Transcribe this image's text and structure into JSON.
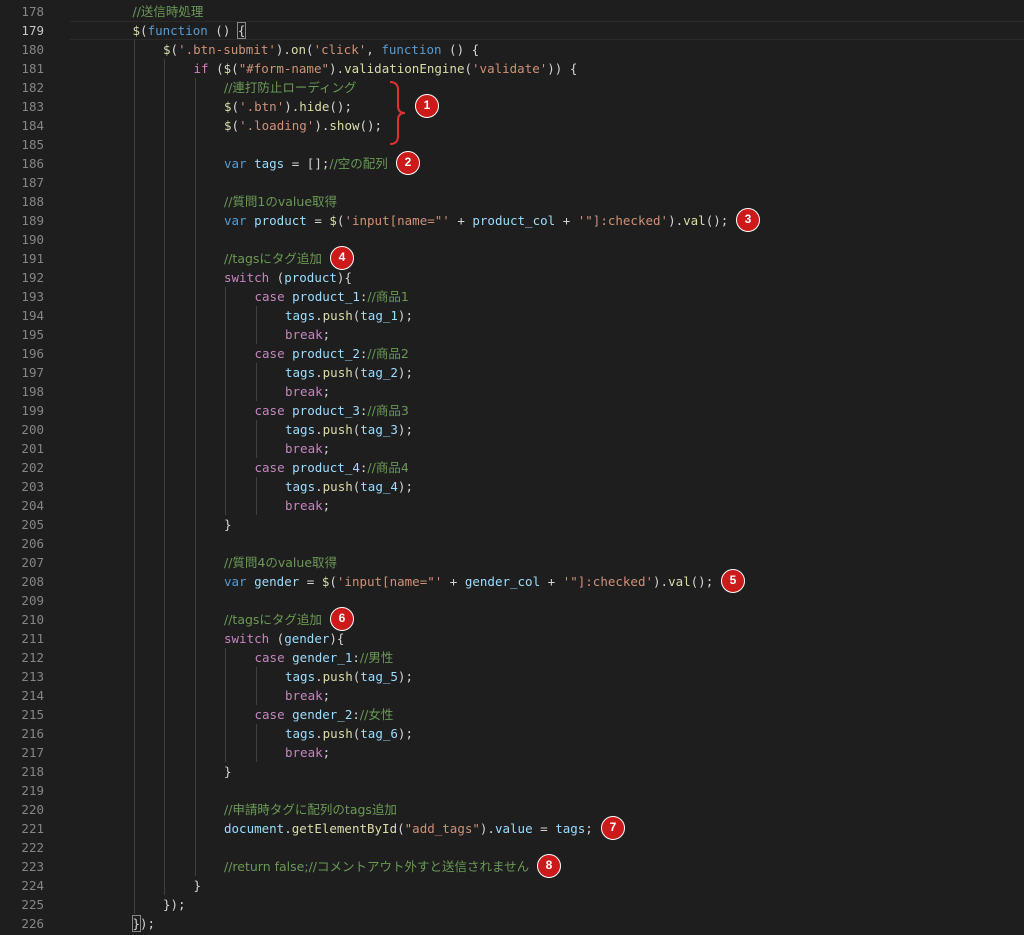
{
  "editor": {
    "active_line": "179",
    "lines": [
      {
        "num": "178"
      },
      {
        "num": "179"
      },
      {
        "num": "180"
      },
      {
        "num": "181"
      },
      {
        "num": "182"
      },
      {
        "num": "183"
      },
      {
        "num": "184"
      },
      {
        "num": "185"
      },
      {
        "num": "186"
      },
      {
        "num": "187"
      },
      {
        "num": "188"
      },
      {
        "num": "189"
      },
      {
        "num": "190"
      },
      {
        "num": "191"
      },
      {
        "num": "192"
      },
      {
        "num": "193"
      },
      {
        "num": "194"
      },
      {
        "num": "195"
      },
      {
        "num": "196"
      },
      {
        "num": "197"
      },
      {
        "num": "198"
      },
      {
        "num": "199"
      },
      {
        "num": "200"
      },
      {
        "num": "201"
      },
      {
        "num": "202"
      },
      {
        "num": "203"
      },
      {
        "num": "204"
      },
      {
        "num": "205"
      },
      {
        "num": "206"
      },
      {
        "num": "207"
      },
      {
        "num": "208"
      },
      {
        "num": "209"
      },
      {
        "num": "210"
      },
      {
        "num": "211"
      },
      {
        "num": "212"
      },
      {
        "num": "213"
      },
      {
        "num": "214"
      },
      {
        "num": "215"
      },
      {
        "num": "216"
      },
      {
        "num": "217"
      },
      {
        "num": "218"
      },
      {
        "num": "219"
      },
      {
        "num": "220"
      },
      {
        "num": "221"
      },
      {
        "num": "222"
      },
      {
        "num": "223"
      },
      {
        "num": "224"
      },
      {
        "num": "225"
      },
      {
        "num": "226"
      }
    ],
    "code": [
      {
        "indent": 1,
        "tokens": [
          {
            "t": "c",
            "v": "//送信時処理"
          }
        ]
      },
      {
        "indent": 1,
        "tokens": [
          {
            "t": "f",
            "v": "$"
          },
          {
            "t": "p",
            "v": "("
          },
          {
            "t": "k",
            "v": "function"
          },
          {
            "t": "p",
            "v": " () "
          },
          {
            "t": "p",
            "v": "{",
            "hl": true
          }
        ]
      },
      {
        "indent": 2,
        "tokens": [
          {
            "t": "f",
            "v": "$"
          },
          {
            "t": "p",
            "v": "("
          },
          {
            "t": "s",
            "v": "'.btn-submit'"
          },
          {
            "t": "p",
            "v": ")."
          },
          {
            "t": "f",
            "v": "on"
          },
          {
            "t": "p",
            "v": "("
          },
          {
            "t": "s",
            "v": "'click'"
          },
          {
            "t": "p",
            "v": ", "
          },
          {
            "t": "k",
            "v": "function"
          },
          {
            "t": "p",
            "v": " () {"
          }
        ]
      },
      {
        "indent": 3,
        "tokens": [
          {
            "t": "ctl",
            "v": "if"
          },
          {
            "t": "p",
            "v": " ("
          },
          {
            "t": "f",
            "v": "$"
          },
          {
            "t": "p",
            "v": "("
          },
          {
            "t": "s",
            "v": "\"#form-name\""
          },
          {
            "t": "p",
            "v": ")."
          },
          {
            "t": "f",
            "v": "validationEngine"
          },
          {
            "t": "p",
            "v": "("
          },
          {
            "t": "s",
            "v": "'validate'"
          },
          {
            "t": "p",
            "v": ")) {"
          }
        ]
      },
      {
        "indent": 4,
        "tokens": [
          {
            "t": "c",
            "v": "//連打防止ローディング"
          }
        ]
      },
      {
        "indent": 4,
        "tokens": [
          {
            "t": "f",
            "v": "$"
          },
          {
            "t": "p",
            "v": "("
          },
          {
            "t": "s",
            "v": "'.btn'"
          },
          {
            "t": "p",
            "v": ")."
          },
          {
            "t": "f",
            "v": "hide"
          },
          {
            "t": "p",
            "v": "();"
          }
        ]
      },
      {
        "indent": 4,
        "tokens": [
          {
            "t": "f",
            "v": "$"
          },
          {
            "t": "p",
            "v": "("
          },
          {
            "t": "s",
            "v": "'.loading'"
          },
          {
            "t": "p",
            "v": ")."
          },
          {
            "t": "f",
            "v": "show"
          },
          {
            "t": "p",
            "v": "();"
          }
        ]
      },
      {
        "indent": 0,
        "tokens": []
      },
      {
        "indent": 4,
        "tokens": [
          {
            "t": "k",
            "v": "var"
          },
          {
            "t": "p",
            "v": " "
          },
          {
            "t": "v",
            "v": "tags"
          },
          {
            "t": "p",
            "v": " = [];"
          },
          {
            "t": "c",
            "v": "//空の配列"
          }
        ]
      },
      {
        "indent": 0,
        "tokens": []
      },
      {
        "indent": 4,
        "tokens": [
          {
            "t": "c",
            "v": "//質問1のvalue取得"
          }
        ]
      },
      {
        "indent": 4,
        "tokens": [
          {
            "t": "k",
            "v": "var"
          },
          {
            "t": "p",
            "v": " "
          },
          {
            "t": "v",
            "v": "product"
          },
          {
            "t": "p",
            "v": " = "
          },
          {
            "t": "f",
            "v": "$"
          },
          {
            "t": "p",
            "v": "("
          },
          {
            "t": "s",
            "v": "'input[name=\"'"
          },
          {
            "t": "p",
            "v": " + "
          },
          {
            "t": "v",
            "v": "product_col"
          },
          {
            "t": "p",
            "v": " + "
          },
          {
            "t": "s",
            "v": "'\"]:checked'"
          },
          {
            "t": "p",
            "v": ")."
          },
          {
            "t": "f",
            "v": "val"
          },
          {
            "t": "p",
            "v": "();"
          }
        ]
      },
      {
        "indent": 0,
        "tokens": []
      },
      {
        "indent": 4,
        "tokens": [
          {
            "t": "c",
            "v": "//tagsにタグ追加"
          }
        ]
      },
      {
        "indent": 4,
        "tokens": [
          {
            "t": "ctl",
            "v": "switch"
          },
          {
            "t": "p",
            "v": " ("
          },
          {
            "t": "v",
            "v": "product"
          },
          {
            "t": "p",
            "v": "){"
          }
        ]
      },
      {
        "indent": 5,
        "tokens": [
          {
            "t": "ctl",
            "v": "case"
          },
          {
            "t": "p",
            "v": " "
          },
          {
            "t": "v",
            "v": "product_1"
          },
          {
            "t": "p",
            "v": ":"
          },
          {
            "t": "c",
            "v": "//商品1"
          }
        ]
      },
      {
        "indent": 6,
        "tokens": [
          {
            "t": "v",
            "v": "tags"
          },
          {
            "t": "p",
            "v": "."
          },
          {
            "t": "f",
            "v": "push"
          },
          {
            "t": "p",
            "v": "("
          },
          {
            "t": "v",
            "v": "tag_1"
          },
          {
            "t": "p",
            "v": ");"
          }
        ]
      },
      {
        "indent": 6,
        "tokens": [
          {
            "t": "ctl",
            "v": "break"
          },
          {
            "t": "p",
            "v": ";"
          }
        ]
      },
      {
        "indent": 5,
        "tokens": [
          {
            "t": "ctl",
            "v": "case"
          },
          {
            "t": "p",
            "v": " "
          },
          {
            "t": "v",
            "v": "product_2"
          },
          {
            "t": "p",
            "v": ":"
          },
          {
            "t": "c",
            "v": "//商品2"
          }
        ]
      },
      {
        "indent": 6,
        "tokens": [
          {
            "t": "v",
            "v": "tags"
          },
          {
            "t": "p",
            "v": "."
          },
          {
            "t": "f",
            "v": "push"
          },
          {
            "t": "p",
            "v": "("
          },
          {
            "t": "v",
            "v": "tag_2"
          },
          {
            "t": "p",
            "v": ");"
          }
        ]
      },
      {
        "indent": 6,
        "tokens": [
          {
            "t": "ctl",
            "v": "break"
          },
          {
            "t": "p",
            "v": ";"
          }
        ]
      },
      {
        "indent": 5,
        "tokens": [
          {
            "t": "ctl",
            "v": "case"
          },
          {
            "t": "p",
            "v": " "
          },
          {
            "t": "v",
            "v": "product_3"
          },
          {
            "t": "p",
            "v": ":"
          },
          {
            "t": "c",
            "v": "//商品3"
          }
        ]
      },
      {
        "indent": 6,
        "tokens": [
          {
            "t": "v",
            "v": "tags"
          },
          {
            "t": "p",
            "v": "."
          },
          {
            "t": "f",
            "v": "push"
          },
          {
            "t": "p",
            "v": "("
          },
          {
            "t": "v",
            "v": "tag_3"
          },
          {
            "t": "p",
            "v": ");"
          }
        ]
      },
      {
        "indent": 6,
        "tokens": [
          {
            "t": "ctl",
            "v": "break"
          },
          {
            "t": "p",
            "v": ";"
          }
        ]
      },
      {
        "indent": 5,
        "tokens": [
          {
            "t": "ctl",
            "v": "case"
          },
          {
            "t": "p",
            "v": " "
          },
          {
            "t": "v",
            "v": "product_4"
          },
          {
            "t": "p",
            "v": ":"
          },
          {
            "t": "c",
            "v": "//商品4"
          }
        ]
      },
      {
        "indent": 6,
        "tokens": [
          {
            "t": "v",
            "v": "tags"
          },
          {
            "t": "p",
            "v": "."
          },
          {
            "t": "f",
            "v": "push"
          },
          {
            "t": "p",
            "v": "("
          },
          {
            "t": "v",
            "v": "tag_4"
          },
          {
            "t": "p",
            "v": ");"
          }
        ]
      },
      {
        "indent": 6,
        "tokens": [
          {
            "t": "ctl",
            "v": "break"
          },
          {
            "t": "p",
            "v": ";"
          }
        ]
      },
      {
        "indent": 4,
        "tokens": [
          {
            "t": "p",
            "v": "}"
          }
        ]
      },
      {
        "indent": 0,
        "tokens": []
      },
      {
        "indent": 4,
        "tokens": [
          {
            "t": "c",
            "v": "//質問4のvalue取得"
          }
        ]
      },
      {
        "indent": 4,
        "tokens": [
          {
            "t": "k",
            "v": "var"
          },
          {
            "t": "p",
            "v": " "
          },
          {
            "t": "v",
            "v": "gender"
          },
          {
            "t": "p",
            "v": " = "
          },
          {
            "t": "f",
            "v": "$"
          },
          {
            "t": "p",
            "v": "("
          },
          {
            "t": "s",
            "v": "'input[name=\"'"
          },
          {
            "t": "p",
            "v": " + "
          },
          {
            "t": "v",
            "v": "gender_col"
          },
          {
            "t": "p",
            "v": " + "
          },
          {
            "t": "s",
            "v": "'\"]:checked'"
          },
          {
            "t": "p",
            "v": ")."
          },
          {
            "t": "f",
            "v": "val"
          },
          {
            "t": "p",
            "v": "();"
          }
        ]
      },
      {
        "indent": 0,
        "tokens": []
      },
      {
        "indent": 4,
        "tokens": [
          {
            "t": "c",
            "v": "//tagsにタグ追加"
          }
        ]
      },
      {
        "indent": 4,
        "tokens": [
          {
            "t": "ctl",
            "v": "switch"
          },
          {
            "t": "p",
            "v": " ("
          },
          {
            "t": "v",
            "v": "gender"
          },
          {
            "t": "p",
            "v": "){"
          }
        ]
      },
      {
        "indent": 5,
        "tokens": [
          {
            "t": "ctl",
            "v": "case"
          },
          {
            "t": "p",
            "v": " "
          },
          {
            "t": "v",
            "v": "gender_1"
          },
          {
            "t": "p",
            "v": ":"
          },
          {
            "t": "c",
            "v": "//男性"
          }
        ]
      },
      {
        "indent": 6,
        "tokens": [
          {
            "t": "v",
            "v": "tags"
          },
          {
            "t": "p",
            "v": "."
          },
          {
            "t": "f",
            "v": "push"
          },
          {
            "t": "p",
            "v": "("
          },
          {
            "t": "v",
            "v": "tag_5"
          },
          {
            "t": "p",
            "v": ");"
          }
        ]
      },
      {
        "indent": 6,
        "tokens": [
          {
            "t": "ctl",
            "v": "break"
          },
          {
            "t": "p",
            "v": ";"
          }
        ]
      },
      {
        "indent": 5,
        "tokens": [
          {
            "t": "ctl",
            "v": "case"
          },
          {
            "t": "p",
            "v": " "
          },
          {
            "t": "v",
            "v": "gender_2"
          },
          {
            "t": "p",
            "v": ":"
          },
          {
            "t": "c",
            "v": "//女性"
          }
        ]
      },
      {
        "indent": 6,
        "tokens": [
          {
            "t": "v",
            "v": "tags"
          },
          {
            "t": "p",
            "v": "."
          },
          {
            "t": "f",
            "v": "push"
          },
          {
            "t": "p",
            "v": "("
          },
          {
            "t": "v",
            "v": "tag_6"
          },
          {
            "t": "p",
            "v": ");"
          }
        ]
      },
      {
        "indent": 6,
        "tokens": [
          {
            "t": "ctl",
            "v": "break"
          },
          {
            "t": "p",
            "v": ";"
          }
        ]
      },
      {
        "indent": 4,
        "tokens": [
          {
            "t": "p",
            "v": "}"
          }
        ]
      },
      {
        "indent": 0,
        "tokens": []
      },
      {
        "indent": 4,
        "tokens": [
          {
            "t": "c",
            "v": "//申請時タグに配列のtags追加"
          }
        ]
      },
      {
        "indent": 4,
        "tokens": [
          {
            "t": "v",
            "v": "document"
          },
          {
            "t": "p",
            "v": "."
          },
          {
            "t": "f",
            "v": "getElementById"
          },
          {
            "t": "p",
            "v": "("
          },
          {
            "t": "s",
            "v": "\"add_tags\""
          },
          {
            "t": "p",
            "v": ")."
          },
          {
            "t": "v",
            "v": "value"
          },
          {
            "t": "p",
            "v": " = "
          },
          {
            "t": "v",
            "v": "tags"
          },
          {
            "t": "p",
            "v": ";"
          }
        ]
      },
      {
        "indent": 0,
        "tokens": []
      },
      {
        "indent": 4,
        "tokens": [
          {
            "t": "c",
            "v": "//return false;//コメントアウト外すと送信されません"
          }
        ]
      },
      {
        "indent": 3,
        "tokens": [
          {
            "t": "p",
            "v": "}"
          }
        ]
      },
      {
        "indent": 2,
        "tokens": [
          {
            "t": "p",
            "v": "});"
          }
        ]
      },
      {
        "indent": 1,
        "tokens": [
          {
            "t": "p",
            "v": "}",
            "hl": true
          },
          {
            "t": "p",
            "v": ");"
          }
        ]
      }
    ]
  },
  "annotations": [
    {
      "label": "1",
      "line_index": 5
    },
    {
      "label": "2",
      "line_index": 8
    },
    {
      "label": "3",
      "line_index": 11
    },
    {
      "label": "4",
      "line_index": 13
    },
    {
      "label": "5",
      "line_index": 30
    },
    {
      "label": "6",
      "line_index": 32
    },
    {
      "label": "7",
      "line_index": 43
    },
    {
      "label": "8",
      "line_index": 45
    }
  ],
  "colors": {
    "background": "#1e1e1e",
    "badge": "#cc1a1a",
    "brace": "#e03030"
  }
}
